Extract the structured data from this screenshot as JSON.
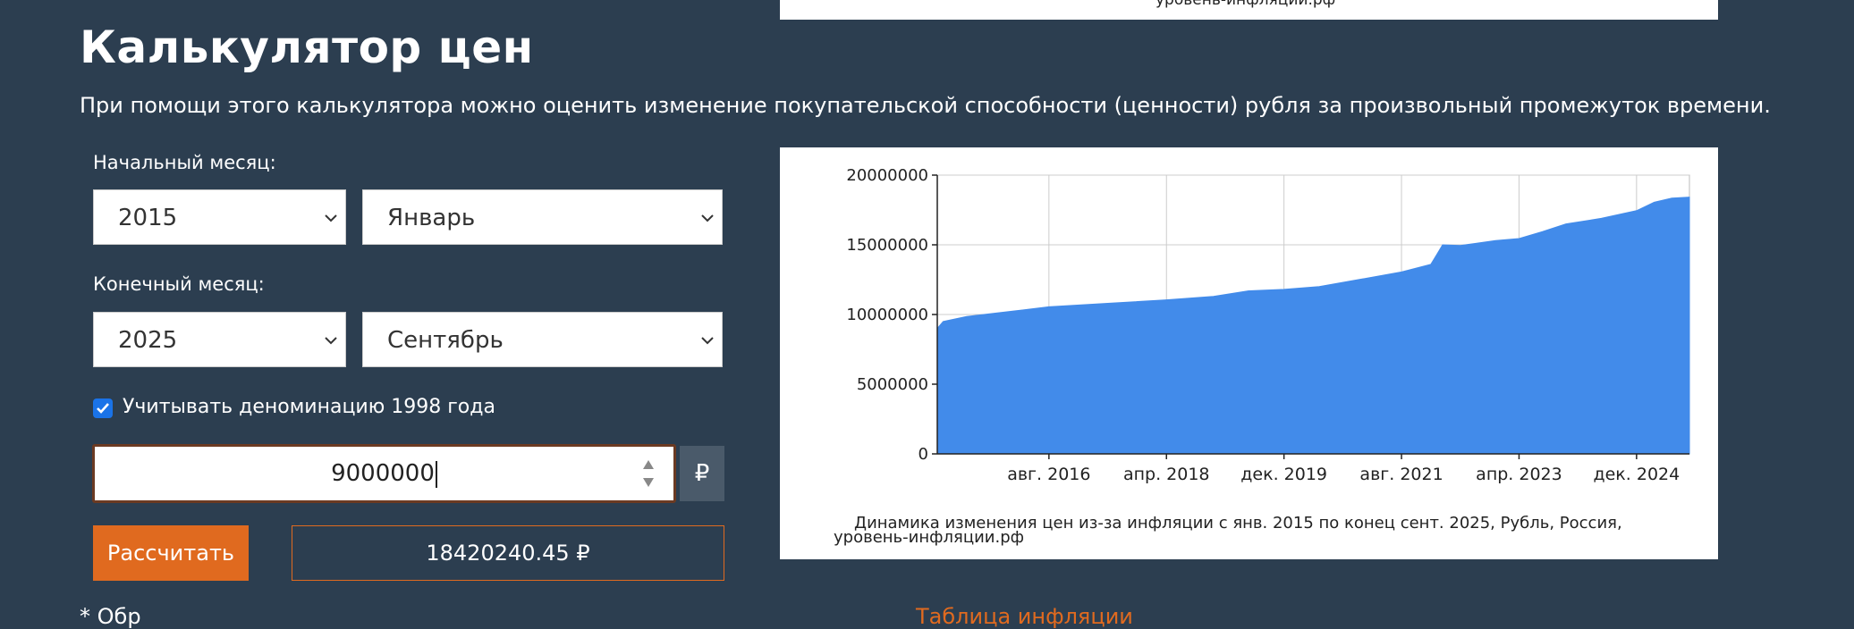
{
  "top_chart_fragment": "уровень-инфляции.рф",
  "page": {
    "title": "Калькулятор цен",
    "description": "При помощи этого калькулятора можно оценить изменение покупательской способности (ценности) рубля за произвольный промежуток времени."
  },
  "form": {
    "start_label": "Начальный месяц:",
    "start_year": "2015",
    "start_month": "Январь",
    "end_label": "Конечный месяц:",
    "end_year": "2025",
    "end_month": "Сентябрь",
    "denomination_checked": true,
    "denomination_label": "Учитывать деноминацию 1998 года",
    "amount": "9000000",
    "currency_symbol": "₽",
    "calc_button": "Рассчитать",
    "result": "18420240.45 ₽"
  },
  "bottom_note": {
    "prefix": "* Обр",
    "link": "Таблица инфляции"
  },
  "colors": {
    "background": "#2c3e50",
    "accent": "#e06a1f",
    "chart_fill": "#428bea"
  },
  "chart_data": {
    "type": "area",
    "title": "Динамика изменения цен из-за инфляции с янв. 2015 по конец сент. 2025, Рубль, Россия,",
    "subtitle": "уровень-инфляции.рф",
    "x_ticks": [
      "авг. 2016",
      "апр. 2018",
      "дек. 2019",
      "авг. 2021",
      "апр. 2023",
      "дек. 2024"
    ],
    "y_ticks": [
      "0",
      "5000000",
      "10000000",
      "15000000",
      "20000000"
    ],
    "ylim": [
      0,
      20000000
    ],
    "xlim": [
      "2015-01",
      "2025-09"
    ],
    "grid": true,
    "series": [
      {
        "points": [
          [
            "2015-01",
            9000000
          ],
          [
            "2015-02",
            9500000
          ],
          [
            "2015-06",
            9850000
          ],
          [
            "2016-01",
            10200000
          ],
          [
            "2016-08",
            10550000
          ],
          [
            "2017-06",
            10800000
          ],
          [
            "2018-04",
            11050000
          ],
          [
            "2018-12",
            11300000
          ],
          [
            "2019-06",
            11700000
          ],
          [
            "2019-12",
            11800000
          ],
          [
            "2020-06",
            12000000
          ],
          [
            "2020-12",
            12450000
          ],
          [
            "2021-08",
            13050000
          ],
          [
            "2022-01",
            13600000
          ],
          [
            "2022-02",
            14300000
          ],
          [
            "2022-03",
            15000000
          ],
          [
            "2022-06",
            14950000
          ],
          [
            "2022-12",
            15300000
          ],
          [
            "2023-04",
            15450000
          ],
          [
            "2023-08",
            15950000
          ],
          [
            "2023-12",
            16500000
          ],
          [
            "2024-06",
            16900000
          ],
          [
            "2024-12",
            17450000
          ],
          [
            "2025-03",
            18050000
          ],
          [
            "2025-06",
            18350000
          ],
          [
            "2025-09",
            18420240
          ]
        ]
      }
    ]
  }
}
